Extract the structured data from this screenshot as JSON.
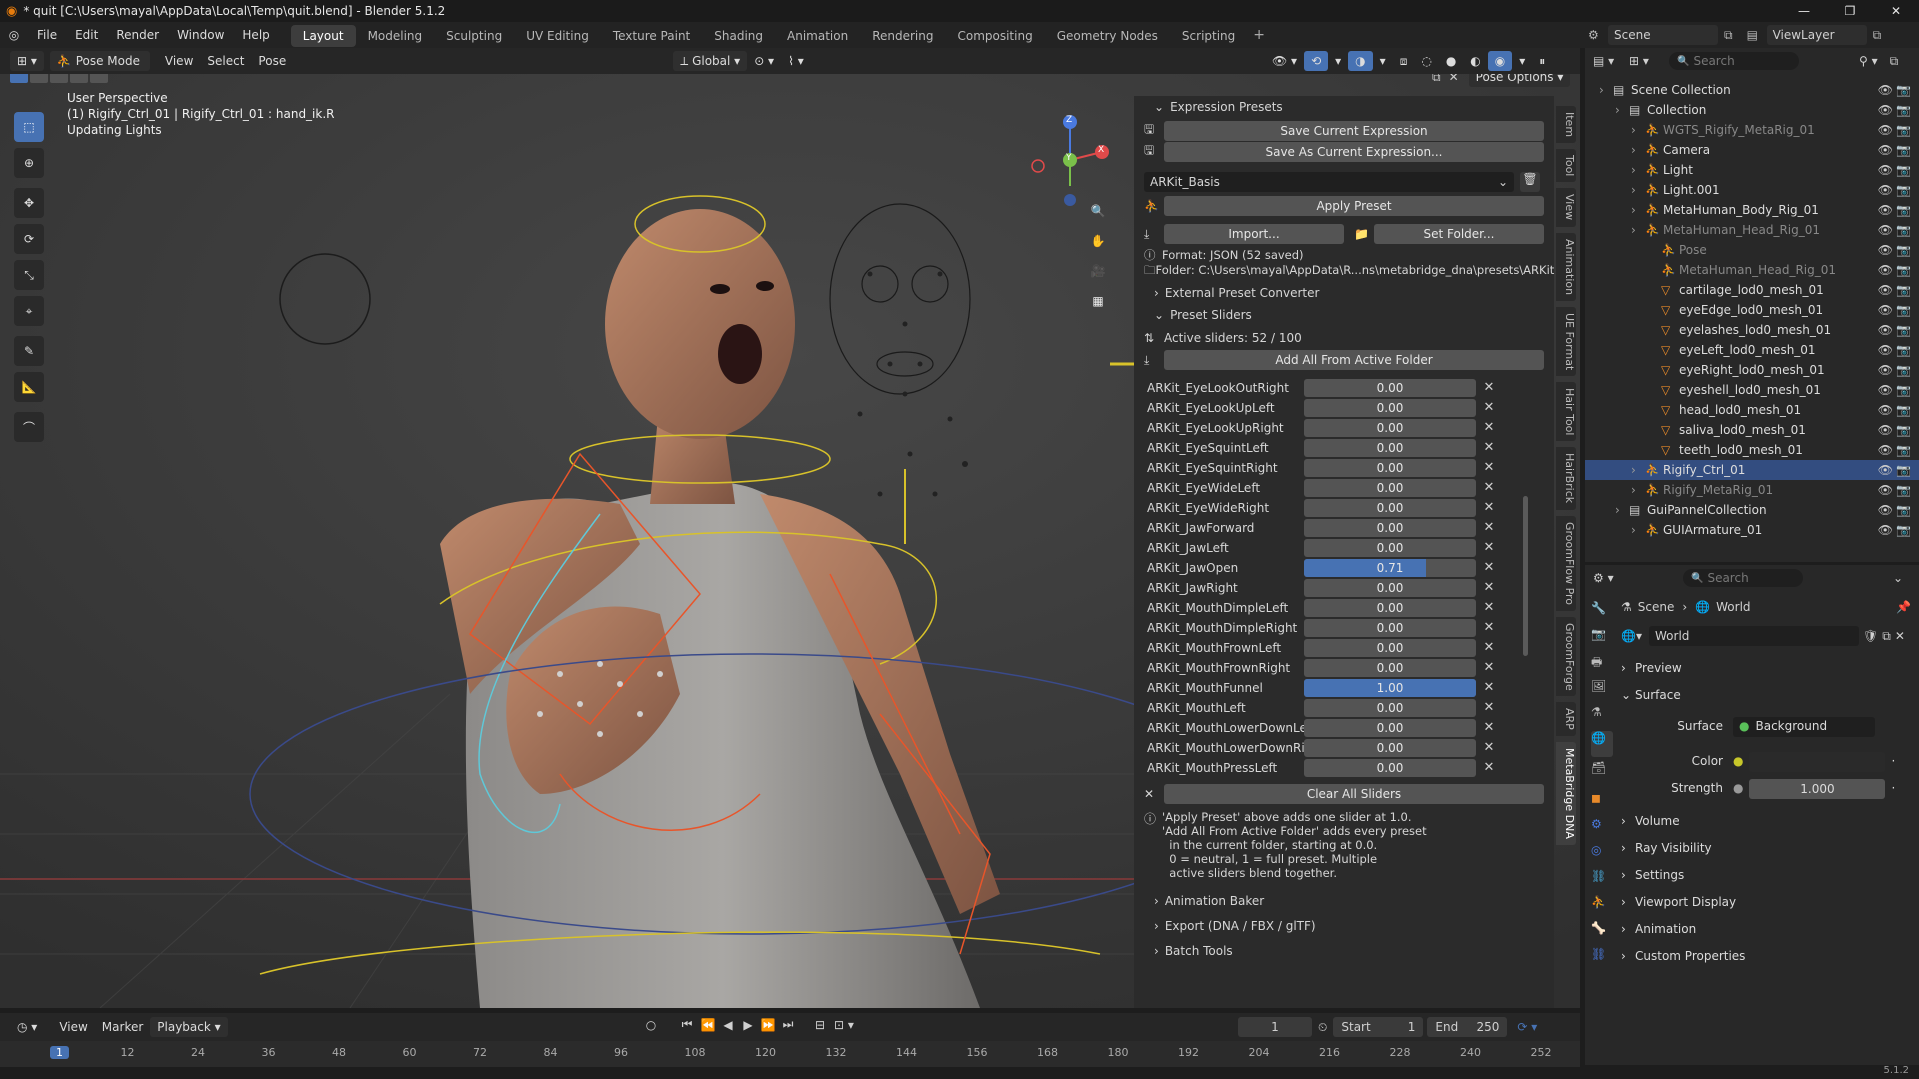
{
  "titlebar": {
    "title": "* quit [C:\\Users\\mayal\\AppData\\Local\\Temp\\quit.blend] - Blender 5.1.2"
  },
  "menu": {
    "items": [
      "File",
      "Edit",
      "Render",
      "Window",
      "Help"
    ]
  },
  "workspaces": [
    "Layout",
    "Modeling",
    "Sculpting",
    "UV Editing",
    "Texture Paint",
    "Shading",
    "Animation",
    "Rendering",
    "Compositing",
    "Geometry Nodes",
    "Scripting"
  ],
  "workspace_active": "Layout",
  "topright": {
    "scene": "Scene",
    "view_layer": "ViewLayer"
  },
  "viewport_header": {
    "mode": "Pose Mode",
    "view": "View",
    "select": "Select",
    "pose": "Pose",
    "orientation": "Global",
    "pose_options": "Pose Options"
  },
  "viewport_info": {
    "line1": "User Perspective",
    "line2": "(1) Rigify_Ctrl_01 | Rigify_Ctrl_01 : hand_ik.R",
    "line3": "Updating Lights"
  },
  "gizmo": {
    "x": "X",
    "y": "Y",
    "z": "Z"
  },
  "npanel": {
    "expression_presets": "Expression Presets",
    "save_current": "Save Current Expression",
    "save_as_current": "Save As Current Expression...",
    "preset_name": "ARKit_Basis",
    "apply_preset": "Apply Preset",
    "import": "Import...",
    "set_folder": "Set Folder...",
    "format": "Format: JSON  (52 saved)",
    "folder": "Folder: C:\\Users\\mayal\\AppData\\R...ns\\metabridge_dna\\presets\\ARKit",
    "external_converter": "External Preset Converter",
    "preset_sliders": "Preset Sliders",
    "active_sliders": "Active sliders: 52 / 100",
    "add_all": "Add All From Active Folder",
    "clear_all": "Clear All Sliders",
    "info": [
      "'Apply Preset' above adds one slider at 1.0.",
      "'Add All From Active Folder' adds every preset",
      "  in the current folder, starting at 0.0.",
      "  0 = neutral, 1 = full preset. Multiple",
      "  active sliders blend together."
    ],
    "animation_baker": "Animation Baker",
    "export": "Export (DNA / FBX / glTF)",
    "batch_tools": "Batch Tools"
  },
  "sliders": [
    {
      "name": "ARKit_EyeLookOutRight",
      "value": "0.00",
      "fill": 0
    },
    {
      "name": "ARKit_EyeLookUpLeft",
      "value": "0.00",
      "fill": 0
    },
    {
      "name": "ARKit_EyeLookUpRight",
      "value": "0.00",
      "fill": 0
    },
    {
      "name": "ARKit_EyeSquintLeft",
      "value": "0.00",
      "fill": 0
    },
    {
      "name": "ARKit_EyeSquintRight",
      "value": "0.00",
      "fill": 0
    },
    {
      "name": "ARKit_EyeWideLeft",
      "value": "0.00",
      "fill": 0
    },
    {
      "name": "ARKit_EyeWideRight",
      "value": "0.00",
      "fill": 0
    },
    {
      "name": "ARKit_JawForward",
      "value": "0.00",
      "fill": 0
    },
    {
      "name": "ARKit_JawLeft",
      "value": "0.00",
      "fill": 0
    },
    {
      "name": "ARKit_JawOpen",
      "value": "0.71",
      "fill": 0.71
    },
    {
      "name": "ARKit_JawRight",
      "value": "0.00",
      "fill": 0
    },
    {
      "name": "ARKit_MouthDimpleLeft",
      "value": "0.00",
      "fill": 0
    },
    {
      "name": "ARKit_MouthDimpleRight",
      "value": "0.00",
      "fill": 0
    },
    {
      "name": "ARKit_MouthFrownLeft",
      "value": "0.00",
      "fill": 0
    },
    {
      "name": "ARKit_MouthFrownRight",
      "value": "0.00",
      "fill": 0
    },
    {
      "name": "ARKit_MouthFunnel",
      "value": "1.00",
      "fill": 1
    },
    {
      "name": "ARKit_MouthLeft",
      "value": "0.00",
      "fill": 0
    },
    {
      "name": "ARKit_MouthLowerDownLeft",
      "value": "0.00",
      "fill": 0
    },
    {
      "name": "ARKit_MouthLowerDownRight",
      "value": "0.00",
      "fill": 0
    },
    {
      "name": "ARKit_MouthPressLeft",
      "value": "0.00",
      "fill": 0
    }
  ],
  "sidebar_tabs": [
    "Item",
    "Tool",
    "View",
    "Animation",
    "UE Format",
    "Hair Tool",
    "HairBrick",
    "GroomFlow Pro",
    "GroomForge",
    "ARP",
    "MetaBridge DNA"
  ],
  "sidebar_tab_active": "MetaBridge DNA",
  "outliner": {
    "search_placeholder": "Search",
    "rows": [
      {
        "label": "Scene Collection",
        "indent": 0,
        "sel": false,
        "dim": false
      },
      {
        "label": "Collection",
        "indent": 1,
        "sel": false,
        "dim": false
      },
      {
        "label": "WGTS_Rigify_MetaRig_01",
        "indent": 2,
        "sel": false,
        "dim": true
      },
      {
        "label": "Camera",
        "indent": 2,
        "sel": false,
        "dim": false
      },
      {
        "label": "Light",
        "indent": 2,
        "sel": false,
        "dim": false
      },
      {
        "label": "Light.001",
        "indent": 2,
        "sel": false,
        "dim": false
      },
      {
        "label": "MetaHuman_Body_Rig_01",
        "indent": 2,
        "sel": false,
        "dim": false
      },
      {
        "label": "MetaHuman_Head_Rig_01",
        "indent": 2,
        "sel": false,
        "dim": true
      },
      {
        "label": "Pose",
        "indent": 3,
        "sel": false,
        "dim": true
      },
      {
        "label": "MetaHuman_Head_Rig_01",
        "indent": 3,
        "sel": false,
        "dim": true
      },
      {
        "label": "cartilage_lod0_mesh_01",
        "indent": 3,
        "sel": false,
        "dim": false
      },
      {
        "label": "eyeEdge_lod0_mesh_01",
        "indent": 3,
        "sel": false,
        "dim": false
      },
      {
        "label": "eyelashes_lod0_mesh_01",
        "indent": 3,
        "sel": false,
        "dim": false
      },
      {
        "label": "eyeLeft_lod0_mesh_01",
        "indent": 3,
        "sel": false,
        "dim": false
      },
      {
        "label": "eyeRight_lod0_mesh_01",
        "indent": 3,
        "sel": false,
        "dim": false
      },
      {
        "label": "eyeshell_lod0_mesh_01",
        "indent": 3,
        "sel": false,
        "dim": false
      },
      {
        "label": "head_lod0_mesh_01",
        "indent": 3,
        "sel": false,
        "dim": false
      },
      {
        "label": "saliva_lod0_mesh_01",
        "indent": 3,
        "sel": false,
        "dim": false
      },
      {
        "label": "teeth_lod0_mesh_01",
        "indent": 3,
        "sel": false,
        "dim": false
      },
      {
        "label": "Rigify_Ctrl_01",
        "indent": 2,
        "sel": true,
        "dim": false
      },
      {
        "label": "Rigify_MetaRig_01",
        "indent": 2,
        "sel": false,
        "dim": true
      },
      {
        "label": "GuiPannelCollection",
        "indent": 1,
        "sel": false,
        "dim": false
      },
      {
        "label": "GUIArmature_01",
        "indent": 2,
        "sel": false,
        "dim": false
      }
    ]
  },
  "properties": {
    "search_placeholder": "Search",
    "breadcrumb_scene": "Scene",
    "breadcrumb_world": "World",
    "world_name": "World",
    "preview": "Preview",
    "surface": "Surface",
    "surface_label": "Surface",
    "surface_value": "Background",
    "color_label": "Color",
    "strength_label": "Strength",
    "strength_value": "1.000",
    "panels": [
      "Volume",
      "Ray Visibility",
      "Settings",
      "Viewport Display",
      "Animation",
      "Custom Properties"
    ]
  },
  "timeline": {
    "view": "View",
    "marker": "Marker",
    "playback": "Playback",
    "current_frame": "1",
    "start_label": "Start",
    "start": "1",
    "end_label": "End",
    "end": "250",
    "ticks": [
      "1",
      "12",
      "24",
      "36",
      "48",
      "60",
      "72",
      "84",
      "96",
      "108",
      "120",
      "132",
      "144",
      "156",
      "168",
      "180",
      "192",
      "204",
      "216",
      "228",
      "240",
      "252"
    ]
  },
  "version": "5.1.2",
  "colors": {
    "accent": "#4772b3",
    "bone_orange": "#e8552a",
    "bone_yellow": "#d8c22a",
    "bone_cyan": "#5fc8d8"
  }
}
